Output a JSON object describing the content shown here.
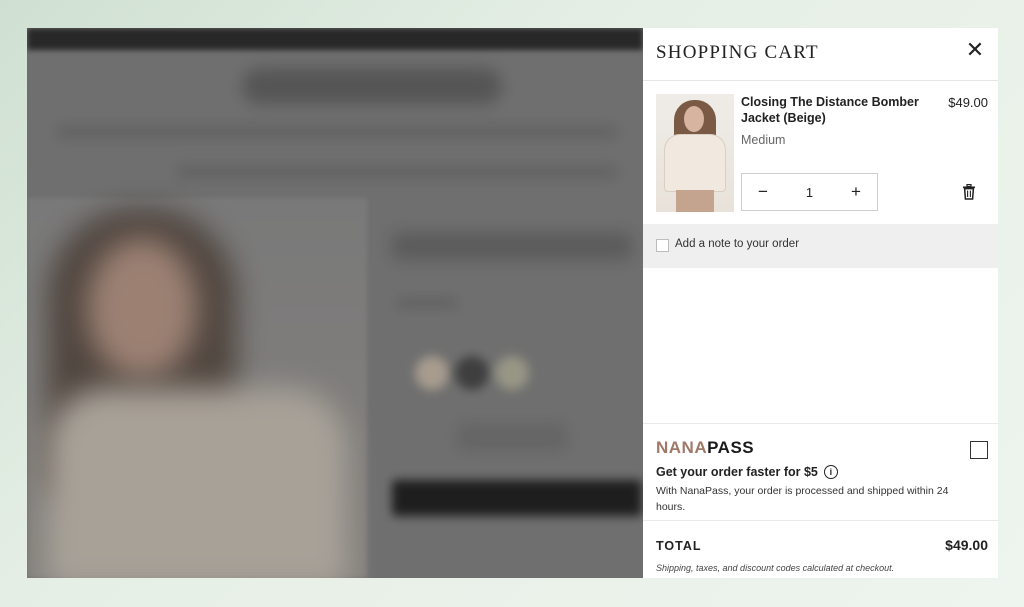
{
  "cart": {
    "title": "SHOPPING CART",
    "close_symbol": "✕",
    "items": [
      {
        "title": "Closing The Distance Bomber Jacket (Beige)",
        "price": "$49.00",
        "variant": "Medium",
        "quantity": "1",
        "decrement_symbol": "−",
        "increment_symbol": "+",
        "icons": {
          "remove": "trash-icon"
        }
      }
    ],
    "note_label": "Add a note to your order",
    "nanapass": {
      "logo_primary": "NANA",
      "logo_secondary": "PASS",
      "heading": "Get your order faster for $5",
      "info_symbol": "i",
      "description": "With NanaPass, your order is processed and shipped within 24 hours."
    },
    "total": {
      "label": "TOTAL",
      "value": "$49.00",
      "note": "Shipping, taxes, and discount codes calculated at checkout."
    }
  },
  "colors": {
    "nanapass_accent": "#a07868",
    "note_bar": "#efefef",
    "background_gradient_start": "#cfe0d2"
  }
}
